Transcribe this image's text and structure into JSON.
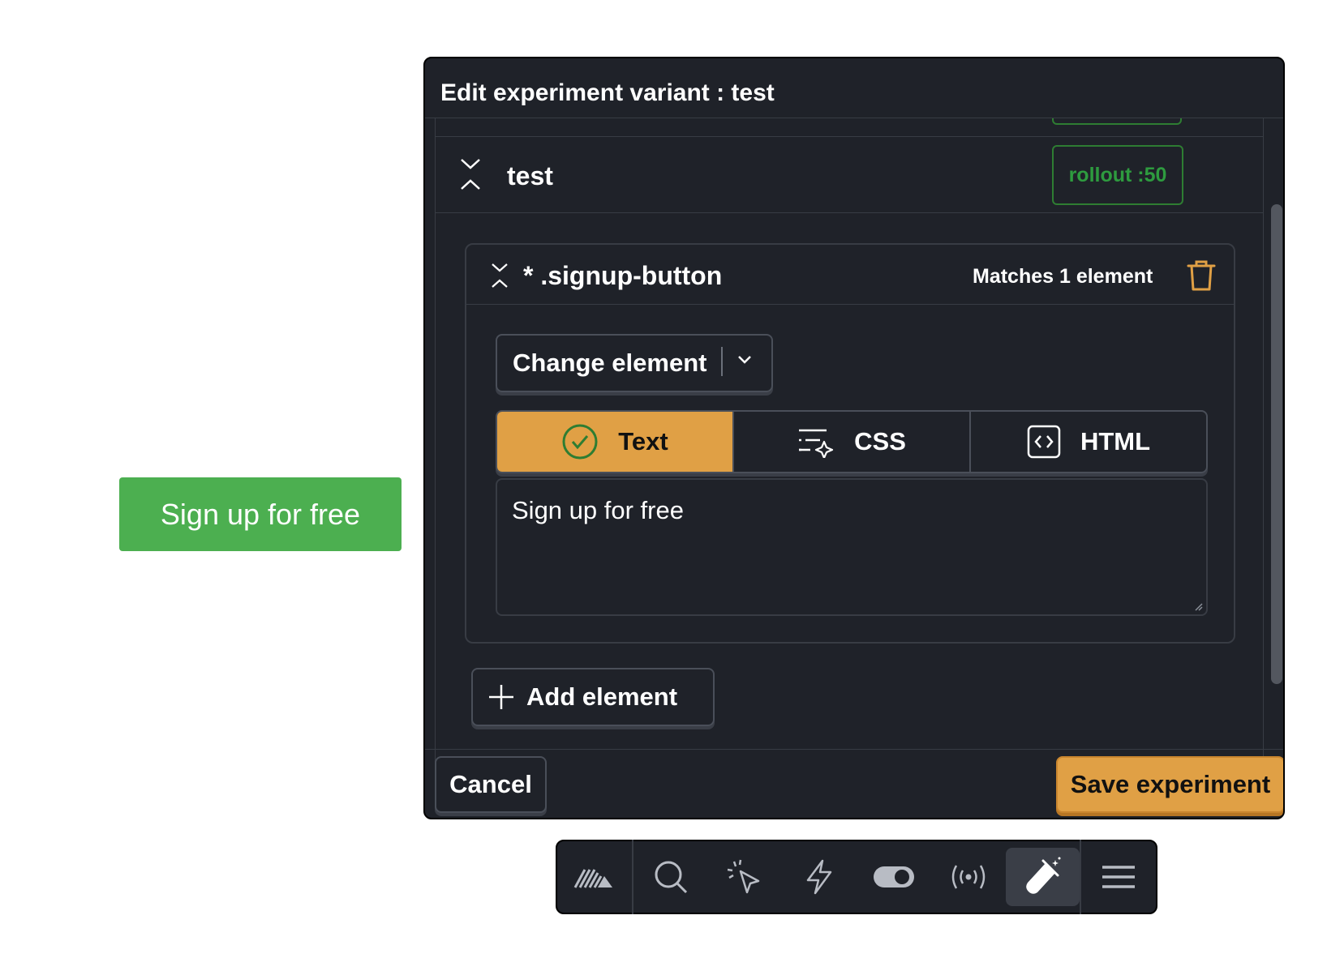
{
  "page": {
    "signup_button_label": "Sign up for free"
  },
  "modal": {
    "title": "Edit experiment variant : test",
    "variant": {
      "name": "test",
      "rollout_label": "rollout :50"
    },
    "element": {
      "selector": "* .signup-button",
      "matches_text": "Matches 1 element",
      "change_dropdown_label": "Change element",
      "tabs": [
        {
          "label": "Text",
          "icon": "check-circle-icon",
          "active": true
        },
        {
          "label": "CSS",
          "icon": "style-sparkle-icon",
          "active": false
        },
        {
          "label": "HTML",
          "icon": "code-brackets-icon",
          "active": false
        }
      ],
      "text_value": "Sign up for free"
    },
    "add_element_label": "Add element",
    "footer": {
      "cancel_label": "Cancel",
      "save_label": "Save experiment"
    }
  },
  "toolbar": {
    "items": [
      {
        "icon": "logo-hedgehog-icon",
        "active": false
      },
      {
        "icon": "search-icon",
        "active": false
      },
      {
        "icon": "cursor-click-icon",
        "active": false
      },
      {
        "icon": "lightning-icon",
        "active": false
      },
      {
        "icon": "toggle-icon",
        "active": false
      },
      {
        "icon": "broadcast-icon",
        "active": false
      },
      {
        "icon": "flask-experiment-icon",
        "active": true
      },
      {
        "icon": "menu-icon",
        "active": false
      }
    ]
  },
  "colors": {
    "signup_green": "#4caf50",
    "panel_bg": "#1f2229",
    "accent_orange": "#e0a045",
    "rollout_green": "#2e9b3f"
  }
}
